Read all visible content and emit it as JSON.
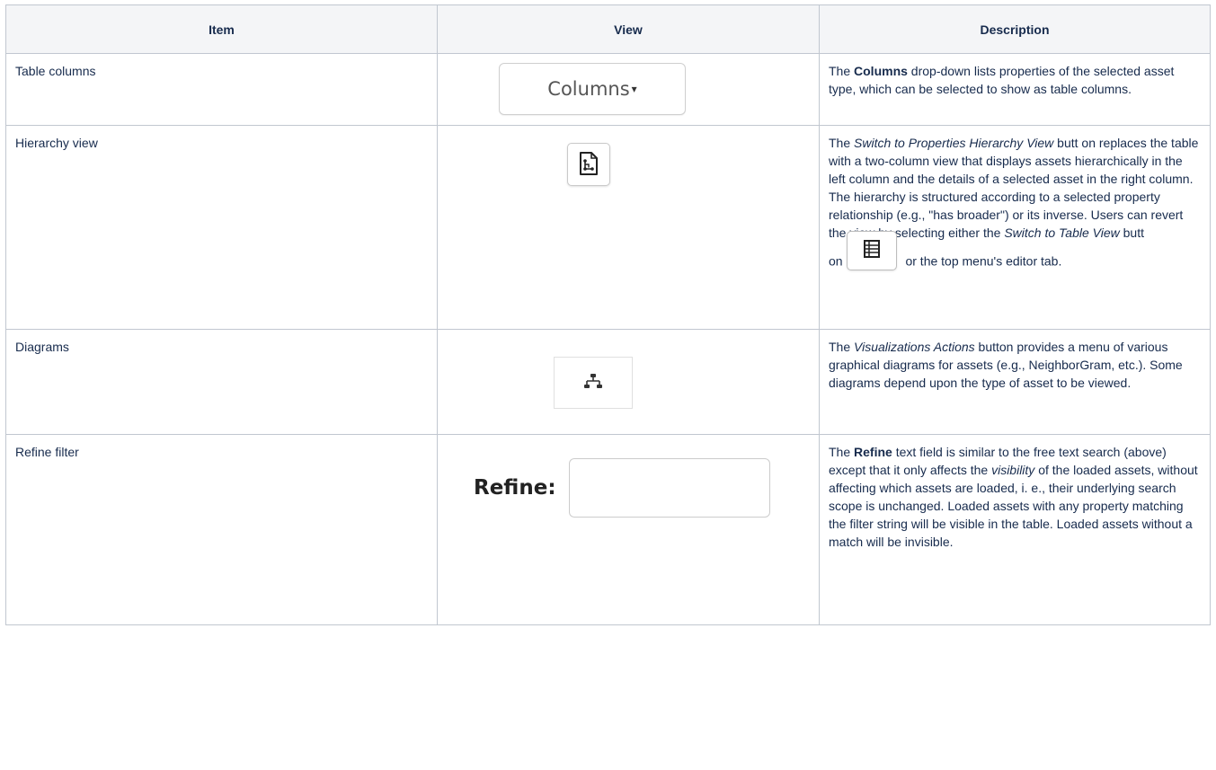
{
  "headers": {
    "item": "Item",
    "view": "View",
    "description": "Description"
  },
  "rows": [
    {
      "item": "Table columns",
      "view": {
        "button_label": "Columns",
        "caret": "▾",
        "icon": "chevron-down-icon"
      },
      "desc": {
        "p1": "The ",
        "b1": "Columns",
        "p2": " drop-down lists properties of the selected asset type, which can be selected to show as table columns."
      }
    },
    {
      "item": "Hierarchy view",
      "view": {
        "icon": "hierarchy-view-icon"
      },
      "desc": {
        "p1": "The ",
        "i1": "Switch to Properties Hierarchy View",
        "p2": " butt on replaces the table with a two-column view that displays assets hierarchically in the left column and the details of a selected asset in the right column. The hierarchy is structured according to a selected property relationship (e.g., \"has broader\") or its inverse. Users can revert the view by selecting either the ",
        "i2": "Switch to Table View",
        "p3": " butt",
        "p4": "on",
        "p5": " or the top menu's editor tab.",
        "icon": "table-view-icon"
      }
    },
    {
      "item": "Diagrams",
      "view": {
        "icon": "visualization-icon"
      },
      "desc": {
        "p1": "The ",
        "i1": "Visualizations Actions",
        "p2": " button  provides a menu of various graphical diagrams for assets (e.g., NeighborGram, etc.). Some diagrams depend upon the type of asset to be viewed."
      }
    },
    {
      "item": "Refine filter",
      "view": {
        "label": "Refine:",
        "value": ""
      },
      "desc": {
        "p1": "The ",
        "b1": "Refine",
        "p2": " text field is similar to the free text search (above) except that it only affects the ",
        "i1": "visibility",
        "p3": " of the loaded assets, without affecting which assets are loaded, i. e., their underlying search scope is unchanged. Loaded assets with any property matching the filter string will be visible in the table. Loaded assets without a match will be invisible."
      }
    }
  ]
}
